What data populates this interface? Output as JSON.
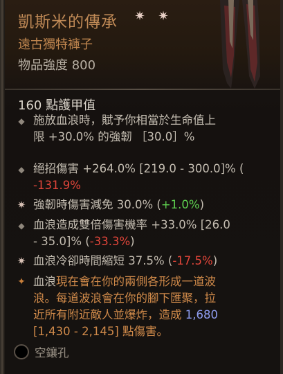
{
  "item": {
    "name": "凱斯米的傳承",
    "type": "遠古獨特褲子",
    "power": "物品強度 800",
    "armor": "160 點護甲值"
  },
  "implicit": {
    "line1": "施放血浪時，賦予你相當於生命值上",
    "line2": "限 +30.0% 的強韌 ［30.0］%"
  },
  "affixes": {
    "a1_l1": "絕招傷害 +264.0% [219.0 - 300.0]% (",
    "a1_l2": "-131.9%",
    "a1_l2_close": ")",
    "a2_text": "強韌時傷害減免 30.0% (",
    "a2_delta": "+1.0%",
    "a2_close": ")",
    "a3_l1": "血浪造成雙倍傷害機率 +33.0% [26.0",
    "a3_l2_pre": "- 35.0]% (",
    "a3_delta": "-33.3%",
    "a3_close": ")",
    "a4_text": "血浪冷卻時間縮短 37.5% (",
    "a4_delta": "-17.5%",
    "a4_close": ")"
  },
  "unique_power": {
    "l1_a": "血浪",
    "l1_b": "現在會在你的兩側各形成一道波",
    "l2": "浪。每道波浪會在你的腳下匯聚，拉",
    "l3_a": "近所有附近敵人並爆炸，造成 ",
    "l3_b": "1,680",
    "l4": "[1,430 - 2,145] 點傷害。"
  },
  "socket": {
    "label": "空鑲孔"
  },
  "colors": {
    "title": "#c08a56",
    "negative": "#e0453a",
    "positive": "#5ed04f",
    "damage_value": "#8e9cf0"
  }
}
